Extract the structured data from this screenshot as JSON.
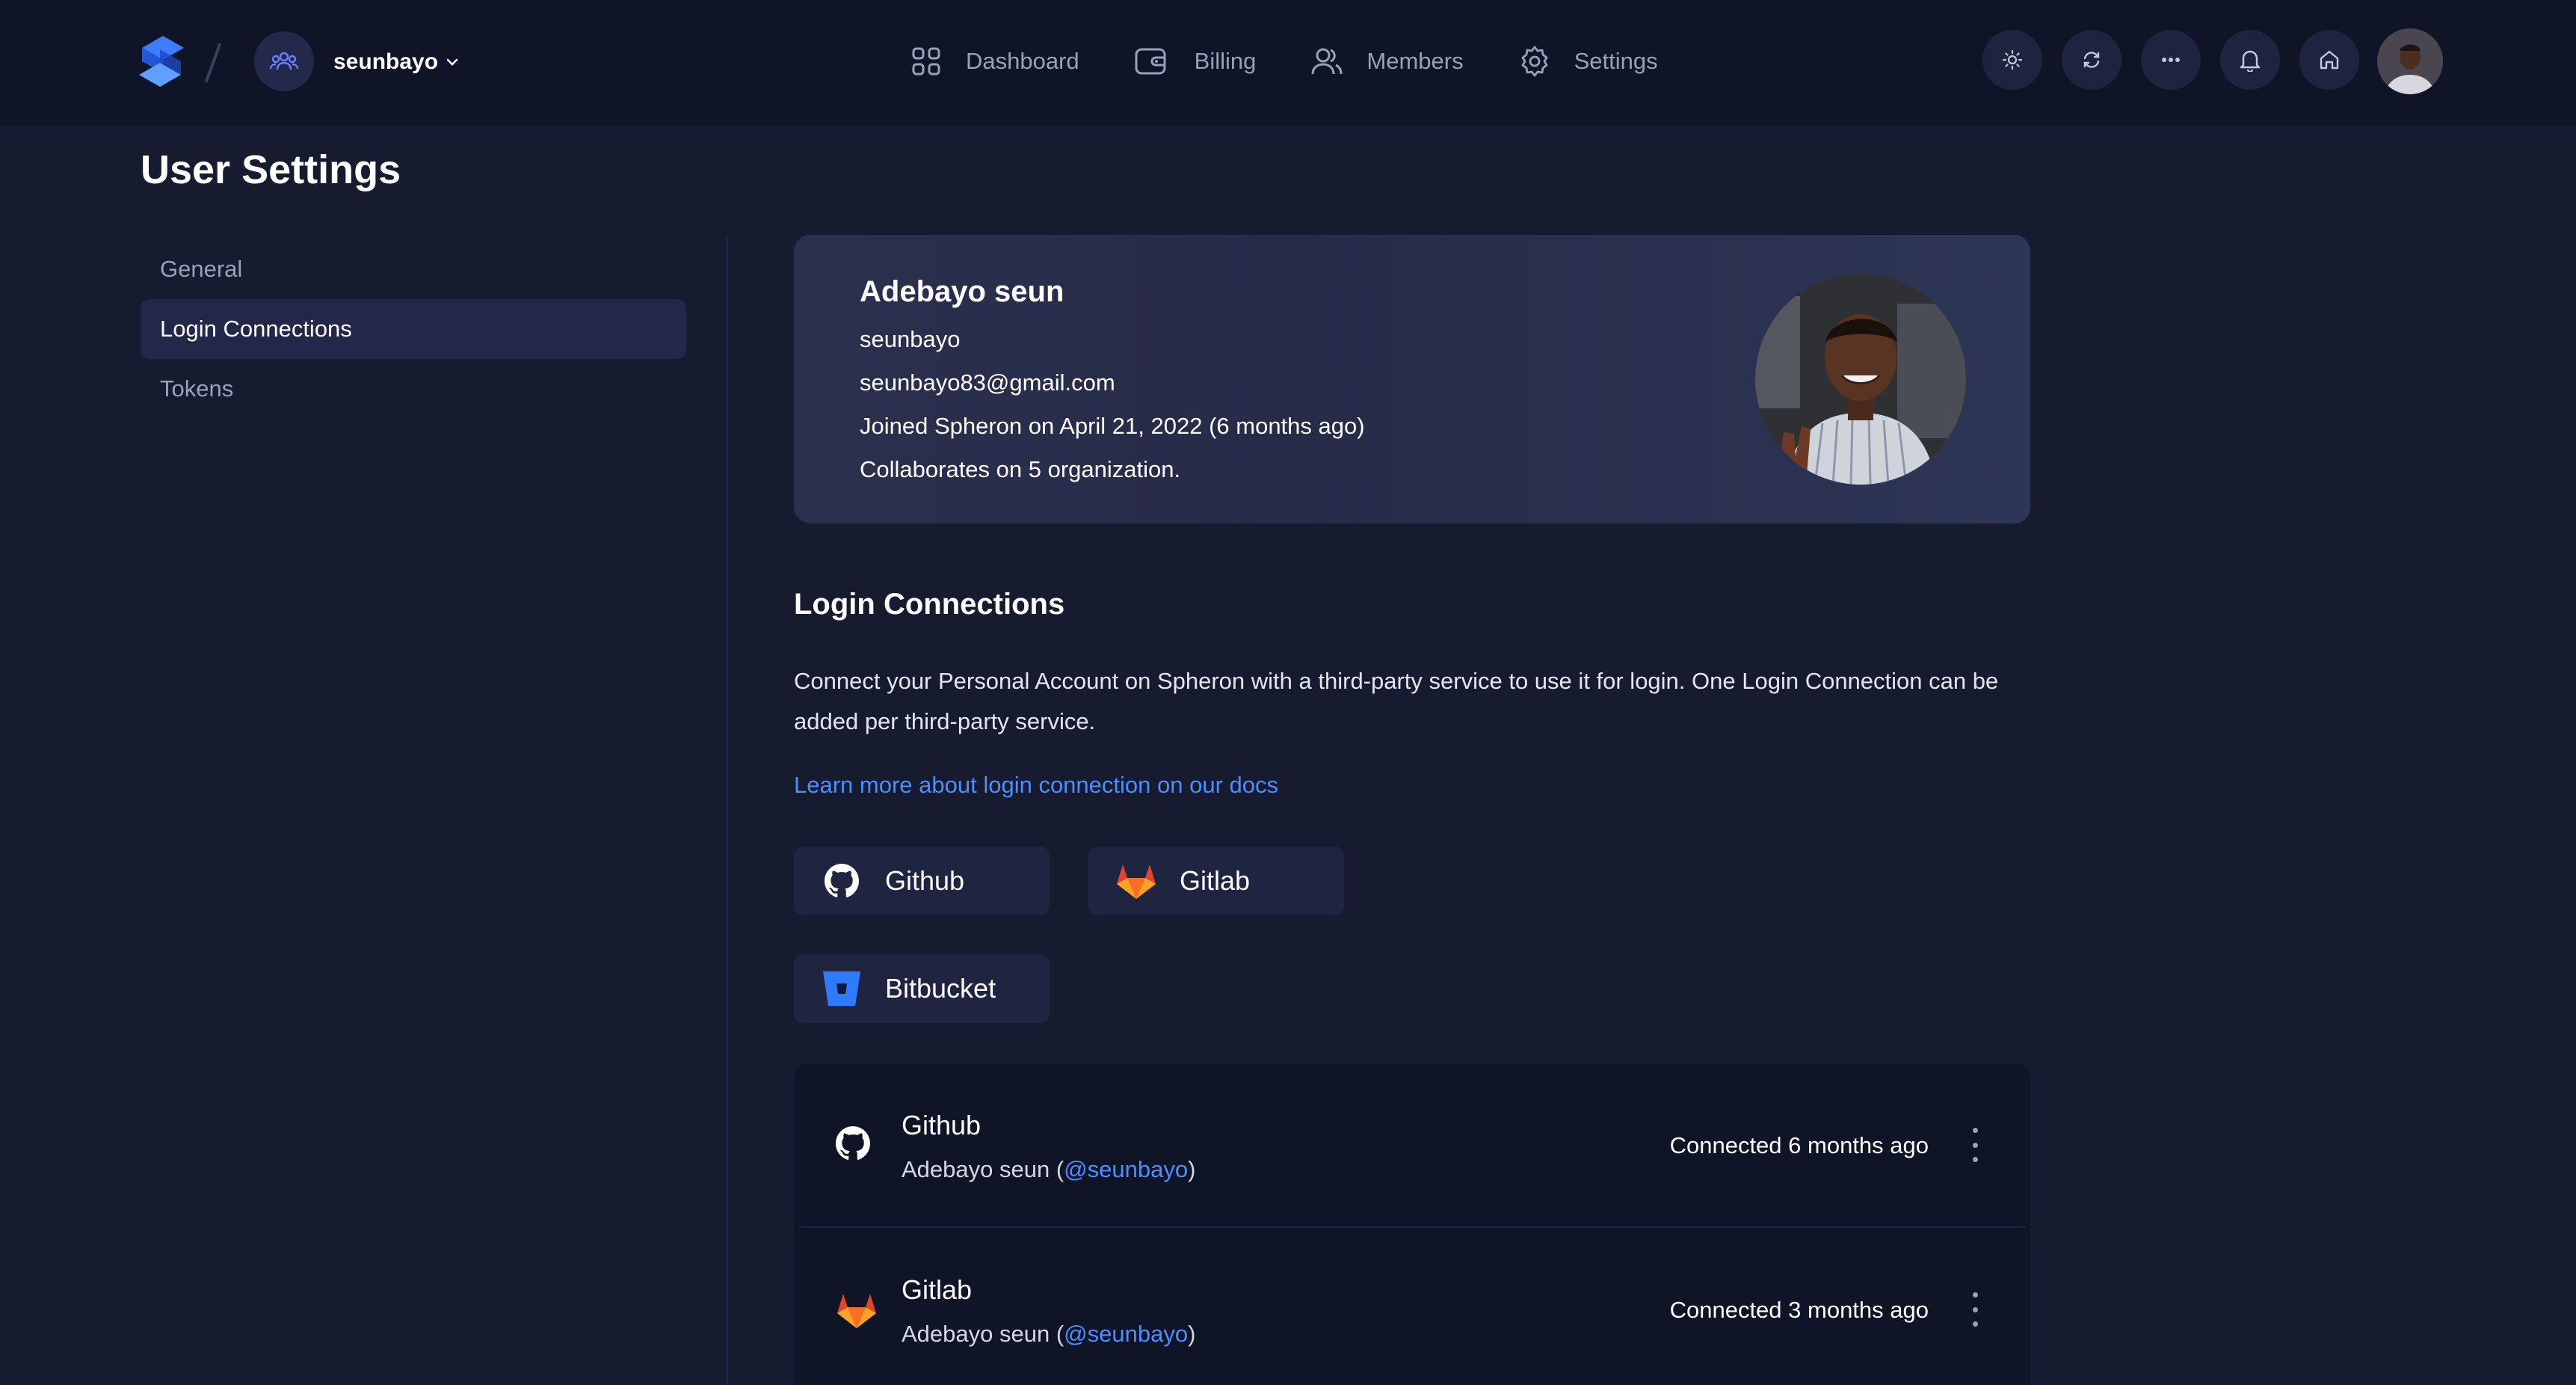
{
  "header": {
    "org_name": "seunbayo",
    "nav": [
      {
        "label": "Dashboard",
        "icon": "grid-icon"
      },
      {
        "label": "Billing",
        "icon": "wallet-icon"
      },
      {
        "label": "Members",
        "icon": "users-icon"
      },
      {
        "label": "Settings",
        "icon": "gear-icon"
      }
    ],
    "actions": [
      "sun-icon",
      "refresh-icon",
      "more-icon",
      "bell-icon",
      "home-icon"
    ]
  },
  "page": {
    "title": "User Settings"
  },
  "sidebar": {
    "items": [
      {
        "label": "General",
        "active": false
      },
      {
        "label": "Login Connections",
        "active": true
      },
      {
        "label": "Tokens",
        "active": false
      }
    ]
  },
  "profile": {
    "name": "Adebayo seun",
    "username": "seunbayo",
    "email": "seunbayo83@gmail.com",
    "joined": "Joined Spheron on April 21, 2022 (6 months ago)",
    "collaborates": "Collaborates on 5 organization."
  },
  "login_connections": {
    "title": "Login Connections",
    "description": "Connect your Personal Account on Spheron with a third-party service to use it for login. One Login Connection can be added per third-party service.",
    "docs_link": "Learn more about login connection on our docs",
    "providers": [
      {
        "label": "Github",
        "icon": "github-icon"
      },
      {
        "label": "Gitlab",
        "icon": "gitlab-icon"
      },
      {
        "label": "Bitbucket",
        "icon": "bitbucket-icon"
      }
    ],
    "connected": [
      {
        "provider": "Github",
        "user_name": "Adebayo seun",
        "open": " (",
        "handle": "@seunbayo",
        "close": ")",
        "status": "Connected 6 months ago"
      },
      {
        "provider": "Gitlab",
        "user_name": "Adebayo seun",
        "open": " (",
        "handle": "@seunbayo",
        "close": ")",
        "status": "Connected 3 months ago"
      }
    ]
  },
  "colors": {
    "background": "#171b30",
    "topbar": "#0f1426",
    "accent_link": "#4c8dff",
    "muted_text": "#9aa0b8"
  }
}
